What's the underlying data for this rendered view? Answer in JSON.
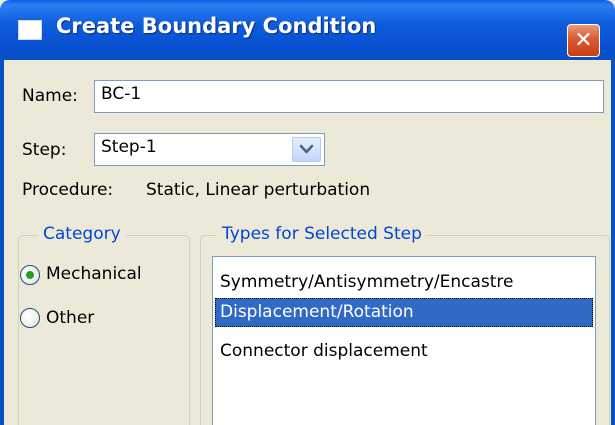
{
  "window": {
    "title": "Create Boundary Condition",
    "close_glyph": "✕"
  },
  "form": {
    "name_label": "Name:",
    "name_value": "BC-1",
    "step_label": "Step:",
    "step_value": "Step-1",
    "procedure_label": "Procedure:",
    "procedure_value": "Static, Linear perturbation"
  },
  "category": {
    "legend": "Category",
    "options": [
      {
        "label": "Mechanical",
        "selected": true
      },
      {
        "label": "Other",
        "selected": false
      }
    ]
  },
  "types": {
    "legend": "Types for Selected Step",
    "items": [
      {
        "label": "Symmetry/Antisymmetry/Encastre",
        "selected": false
      },
      {
        "label": "Displacement/Rotation",
        "selected": true
      },
      {
        "label": "Connector displacement",
        "selected": false
      }
    ]
  },
  "colors": {
    "title_bar": "#0a5fe6",
    "legend_text": "#0046d5",
    "selection": "#316ac5",
    "radio_dot": "#21a121",
    "dialog_bg": "#ece9d8"
  },
  "icons": {
    "app": "window-icon",
    "close": "close-icon",
    "dropdown": "chevron-down-icon"
  }
}
